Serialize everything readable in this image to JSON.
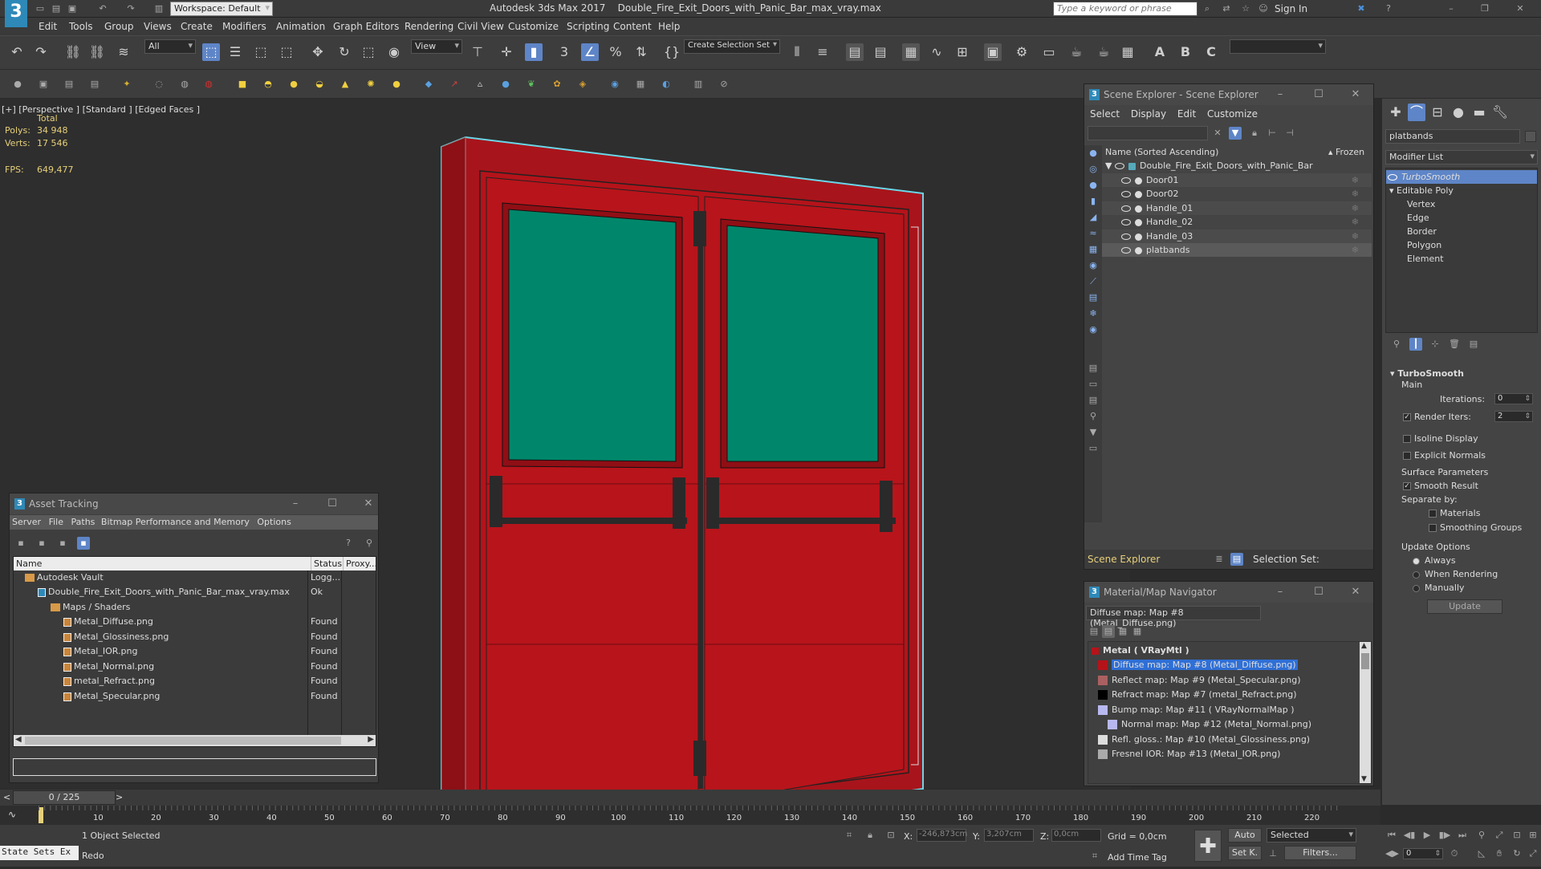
{
  "title": {
    "workspace": "Workspace: Default",
    "app": "Autodesk 3ds Max 2017",
    "file": "Double_Fire_Exit_Doors_with_Panic_Bar_max_vray.max",
    "search_placeholder": "Type a keyword or phrase",
    "sign_in": "Sign In"
  },
  "menu": [
    "Edit",
    "Tools",
    "Group",
    "Views",
    "Create",
    "Modifiers",
    "Animation",
    "Graph Editors",
    "Rendering",
    "Civil View",
    "Customize",
    "Scripting",
    "Content",
    "Help"
  ],
  "toolbar": {
    "filter": "All",
    "view": "View",
    "selection_set": "Create Selection Set",
    "zero": "0"
  },
  "viewport": {
    "label": "[+] [Perspective ] [Standard ] [Edged Faces ]",
    "total": "Total",
    "polys_label": "Polys:",
    "polys": "34 948",
    "verts_label": "Verts:",
    "verts": "17 546",
    "fps_label": "FPS:",
    "fps": "649,477",
    "door_color": "#b5131a",
    "glass_color": "#00876b"
  },
  "asset_tracking": {
    "title": "Asset Tracking",
    "menu": [
      "Server",
      "File",
      "Paths",
      "Bitmap Performance and Memory",
      "Options"
    ],
    "columns": [
      "Name",
      "Status",
      "Proxy..."
    ],
    "rows": [
      {
        "name": "Autodesk Vault",
        "status": "Logg..."
      },
      {
        "name": "Double_Fire_Exit_Doors_with_Panic_Bar_max_vray.max",
        "status": "Ok"
      },
      {
        "name": "Maps / Shaders",
        "status": ""
      },
      {
        "name": "Metal_Diffuse.png",
        "status": "Found"
      },
      {
        "name": "Metal_Glossiness.png",
        "status": "Found"
      },
      {
        "name": "Metal_IOR.png",
        "status": "Found"
      },
      {
        "name": "Metal_Normal.png",
        "status": "Found"
      },
      {
        "name": "metal_Refract.png",
        "status": "Found"
      },
      {
        "name": "Metal_Specular.png",
        "status": "Found"
      }
    ]
  },
  "scene_explorer": {
    "title": "Scene Explorer - Scene Explorer",
    "menu": [
      "Select",
      "Display",
      "Edit",
      "Customize"
    ],
    "col_name": "Name (Sorted Ascending)",
    "col_frozen": "▴ Frozen",
    "root": "Double_Fire_Exit_Doors_with_Panic_Bar",
    "items": [
      "Door01",
      "Door02",
      "Handle_01",
      "Handle_02",
      "Handle_03",
      "platbands"
    ],
    "footer_label": "Scene Explorer",
    "selection_set": "Selection Set:"
  },
  "material_nav": {
    "title": "Material/Map Navigator",
    "current": "Diffuse map: Map #8 (Metal_Diffuse.png)",
    "root": "Metal  ( VRayMtl )",
    "maps": [
      "Diffuse map: Map #8 (Metal_Diffuse.png)",
      "Reflect map: Map #9 (Metal_Specular.png)",
      "Refract map: Map #7 (metal_Refract.png)",
      "Bump map: Map #11  ( VRayNormalMap )",
      "Normal map: Map #12 (Metal_Normal.png)",
      "Refl. gloss.: Map #10 (Metal_Glossiness.png)",
      "Fresnel IOR: Map #13 (Metal_IOR.png)"
    ]
  },
  "modify_panel": {
    "object_name": "platbands",
    "modifier_list": "Modifier List",
    "stack": [
      "TurboSmooth",
      "Editable Poly",
      "Vertex",
      "Edge",
      "Border",
      "Polygon",
      "Element"
    ],
    "rollout": "TurboSmooth",
    "main": "Main",
    "iterations_label": "Iterations:",
    "iterations": "0",
    "render_iters_label": "Render Iters:",
    "render_iters": "2",
    "isoline": "Isoline Display",
    "explicit_normals": "Explicit Normals",
    "surface_params": "Surface Parameters",
    "smooth_result": "Smooth Result",
    "separate_by": "Separate by:",
    "materials": "Materials",
    "smoothing_groups": "Smoothing Groups",
    "update_options": "Update Options",
    "always": "Always",
    "when_rendering": "When Rendering",
    "manually": "Manually",
    "update": "Update"
  },
  "timeline": {
    "frame": "0 / 225",
    "ticks": [
      "10",
      "20",
      "30",
      "40",
      "50",
      "60",
      "70",
      "80",
      "90",
      "100",
      "110",
      "120",
      "130",
      "140",
      "150",
      "160",
      "170",
      "180",
      "190",
      "200",
      "210",
      "220"
    ]
  },
  "status": {
    "state_sets": "State Sets Ex",
    "selected": "1 Object Selected",
    "prompt": "Redo",
    "x_label": "X:",
    "x": "-246,873cm",
    "y_label": "Y:",
    "y": "3,207cm",
    "z_label": "Z:",
    "z": "0,0cm",
    "grid": "Grid = 0,0cm",
    "add_time_tag": "Add Time Tag",
    "auto": "Auto",
    "set_k": "Set K.",
    "selected_dd": "Selected",
    "filters": "Filters...",
    "frame_spin": "0"
  }
}
